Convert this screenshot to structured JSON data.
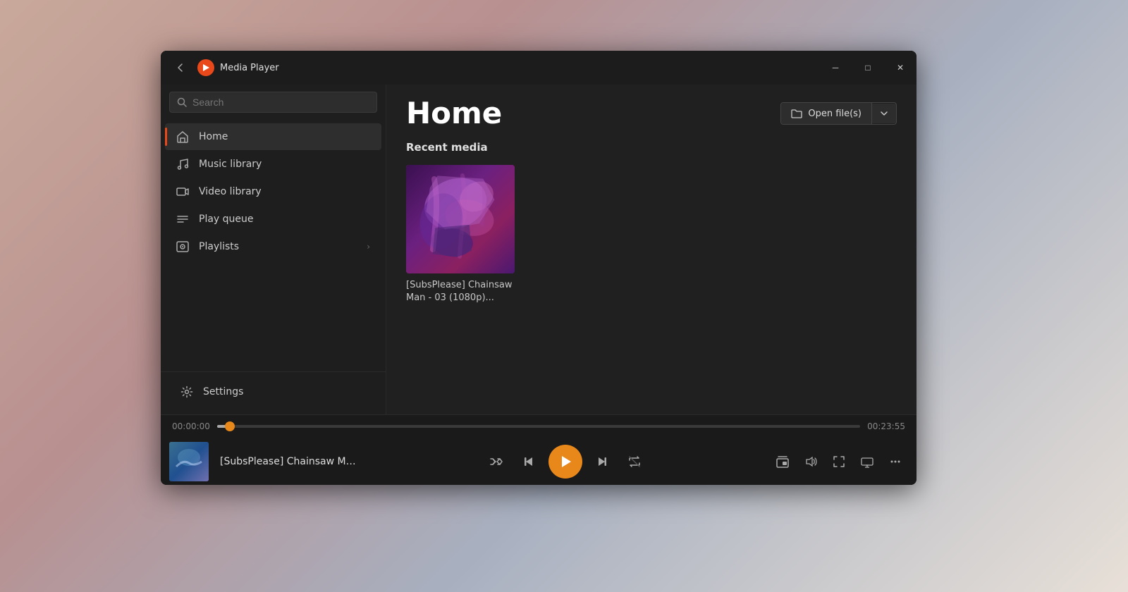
{
  "app": {
    "title": "Media Player",
    "icon_label": "play-icon"
  },
  "titlebar": {
    "back_label": "‹",
    "minimize_label": "─",
    "maximize_label": "□",
    "close_label": "✕"
  },
  "sidebar": {
    "search_placeholder": "Search",
    "nav_items": [
      {
        "id": "home",
        "label": "Home",
        "icon": "home",
        "active": true
      },
      {
        "id": "music-library",
        "label": "Music library",
        "icon": "music",
        "active": false
      },
      {
        "id": "video-library",
        "label": "Video library",
        "icon": "video",
        "active": false
      },
      {
        "id": "play-queue",
        "label": "Play queue",
        "icon": "queue",
        "active": false
      },
      {
        "id": "playlists",
        "label": "Playlists",
        "icon": "playlist",
        "active": false,
        "has_chevron": true
      }
    ],
    "settings_label": "Settings"
  },
  "content": {
    "page_title": "Home",
    "open_files_label": "Open file(s)",
    "recent_media_title": "Recent media",
    "media_items": [
      {
        "id": "chainsaw-man",
        "title": "[SubsPlease] Chainsaw Man - 03 (1080p)..."
      }
    ]
  },
  "player": {
    "current_time": "00:00:00",
    "total_time": "00:23:55",
    "track_title": "[SubsPlease] Chainsaw Man...",
    "progress_percent": 2,
    "controls": {
      "shuffle_label": "Shuffle",
      "prev_label": "Previous",
      "play_label": "Play",
      "next_label": "Next",
      "repeat_label": "Repeat"
    },
    "right_controls": {
      "miniplayer_label": "Mini player",
      "volume_label": "Volume",
      "fullscreen_label": "Full screen",
      "cast_label": "Cast",
      "more_label": "More"
    }
  }
}
